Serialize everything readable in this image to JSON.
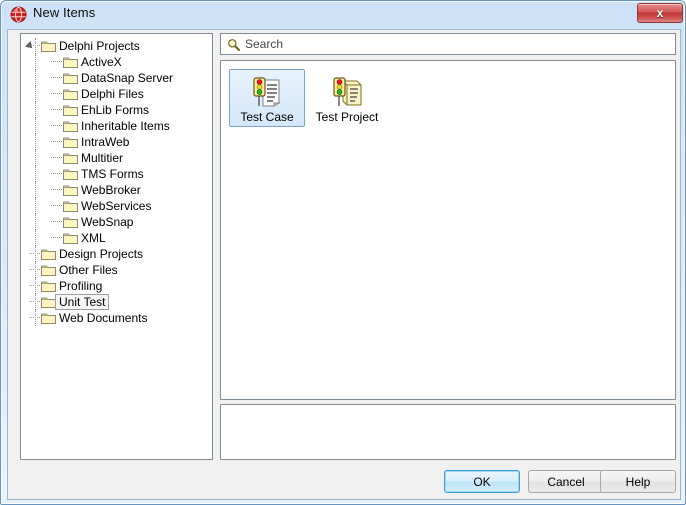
{
  "window": {
    "title": "New Items",
    "icon": "delphi-globe-icon",
    "close_label": "x"
  },
  "tree": {
    "items": [
      {
        "label": "Delphi Projects",
        "level": 0,
        "expanded": true,
        "selected": false
      },
      {
        "label": "ActiveX",
        "level": 1,
        "expanded": false,
        "selected": false
      },
      {
        "label": "DataSnap Server",
        "level": 1,
        "expanded": false,
        "selected": false
      },
      {
        "label": "Delphi Files",
        "level": 1,
        "expanded": false,
        "selected": false
      },
      {
        "label": "EhLib Forms",
        "level": 1,
        "expanded": false,
        "selected": false
      },
      {
        "label": "Inheritable Items",
        "level": 1,
        "expanded": false,
        "selected": false
      },
      {
        "label": "IntraWeb",
        "level": 1,
        "expanded": false,
        "selected": false
      },
      {
        "label": "Multitier",
        "level": 1,
        "expanded": false,
        "selected": false
      },
      {
        "label": "TMS Forms",
        "level": 1,
        "expanded": false,
        "selected": false
      },
      {
        "label": "WebBroker",
        "level": 1,
        "expanded": false,
        "selected": false
      },
      {
        "label": "WebServices",
        "level": 1,
        "expanded": false,
        "selected": false
      },
      {
        "label": "WebSnap",
        "level": 1,
        "expanded": false,
        "selected": false
      },
      {
        "label": "XML",
        "level": 1,
        "expanded": false,
        "selected": false
      },
      {
        "label": "Design Projects",
        "level": 0,
        "expanded": false,
        "selected": false
      },
      {
        "label": "Other Files",
        "level": 0,
        "expanded": false,
        "selected": false
      },
      {
        "label": "Profiling",
        "level": 0,
        "expanded": false,
        "selected": false
      },
      {
        "label": "Unit Test",
        "level": 0,
        "expanded": false,
        "selected": true
      },
      {
        "label": "Web Documents",
        "level": 0,
        "expanded": false,
        "selected": false
      }
    ]
  },
  "search": {
    "placeholder": "Search",
    "value": "",
    "icon": "magnifier-icon"
  },
  "items": {
    "entries": [
      {
        "label": "Test Case",
        "icon": "traffic-light-document-icon",
        "selected": true
      },
      {
        "label": "Test Project",
        "icon": "traffic-light-folder-icon",
        "selected": false
      }
    ]
  },
  "description": {
    "text": ""
  },
  "buttons": {
    "ok": "OK",
    "cancel": "Cancel",
    "help": "Help"
  },
  "colors": {
    "titlebar": "#cde2f7",
    "accent": "#3c9fd4",
    "folder": "#fdf5c0",
    "close_button": "#bf3535"
  }
}
